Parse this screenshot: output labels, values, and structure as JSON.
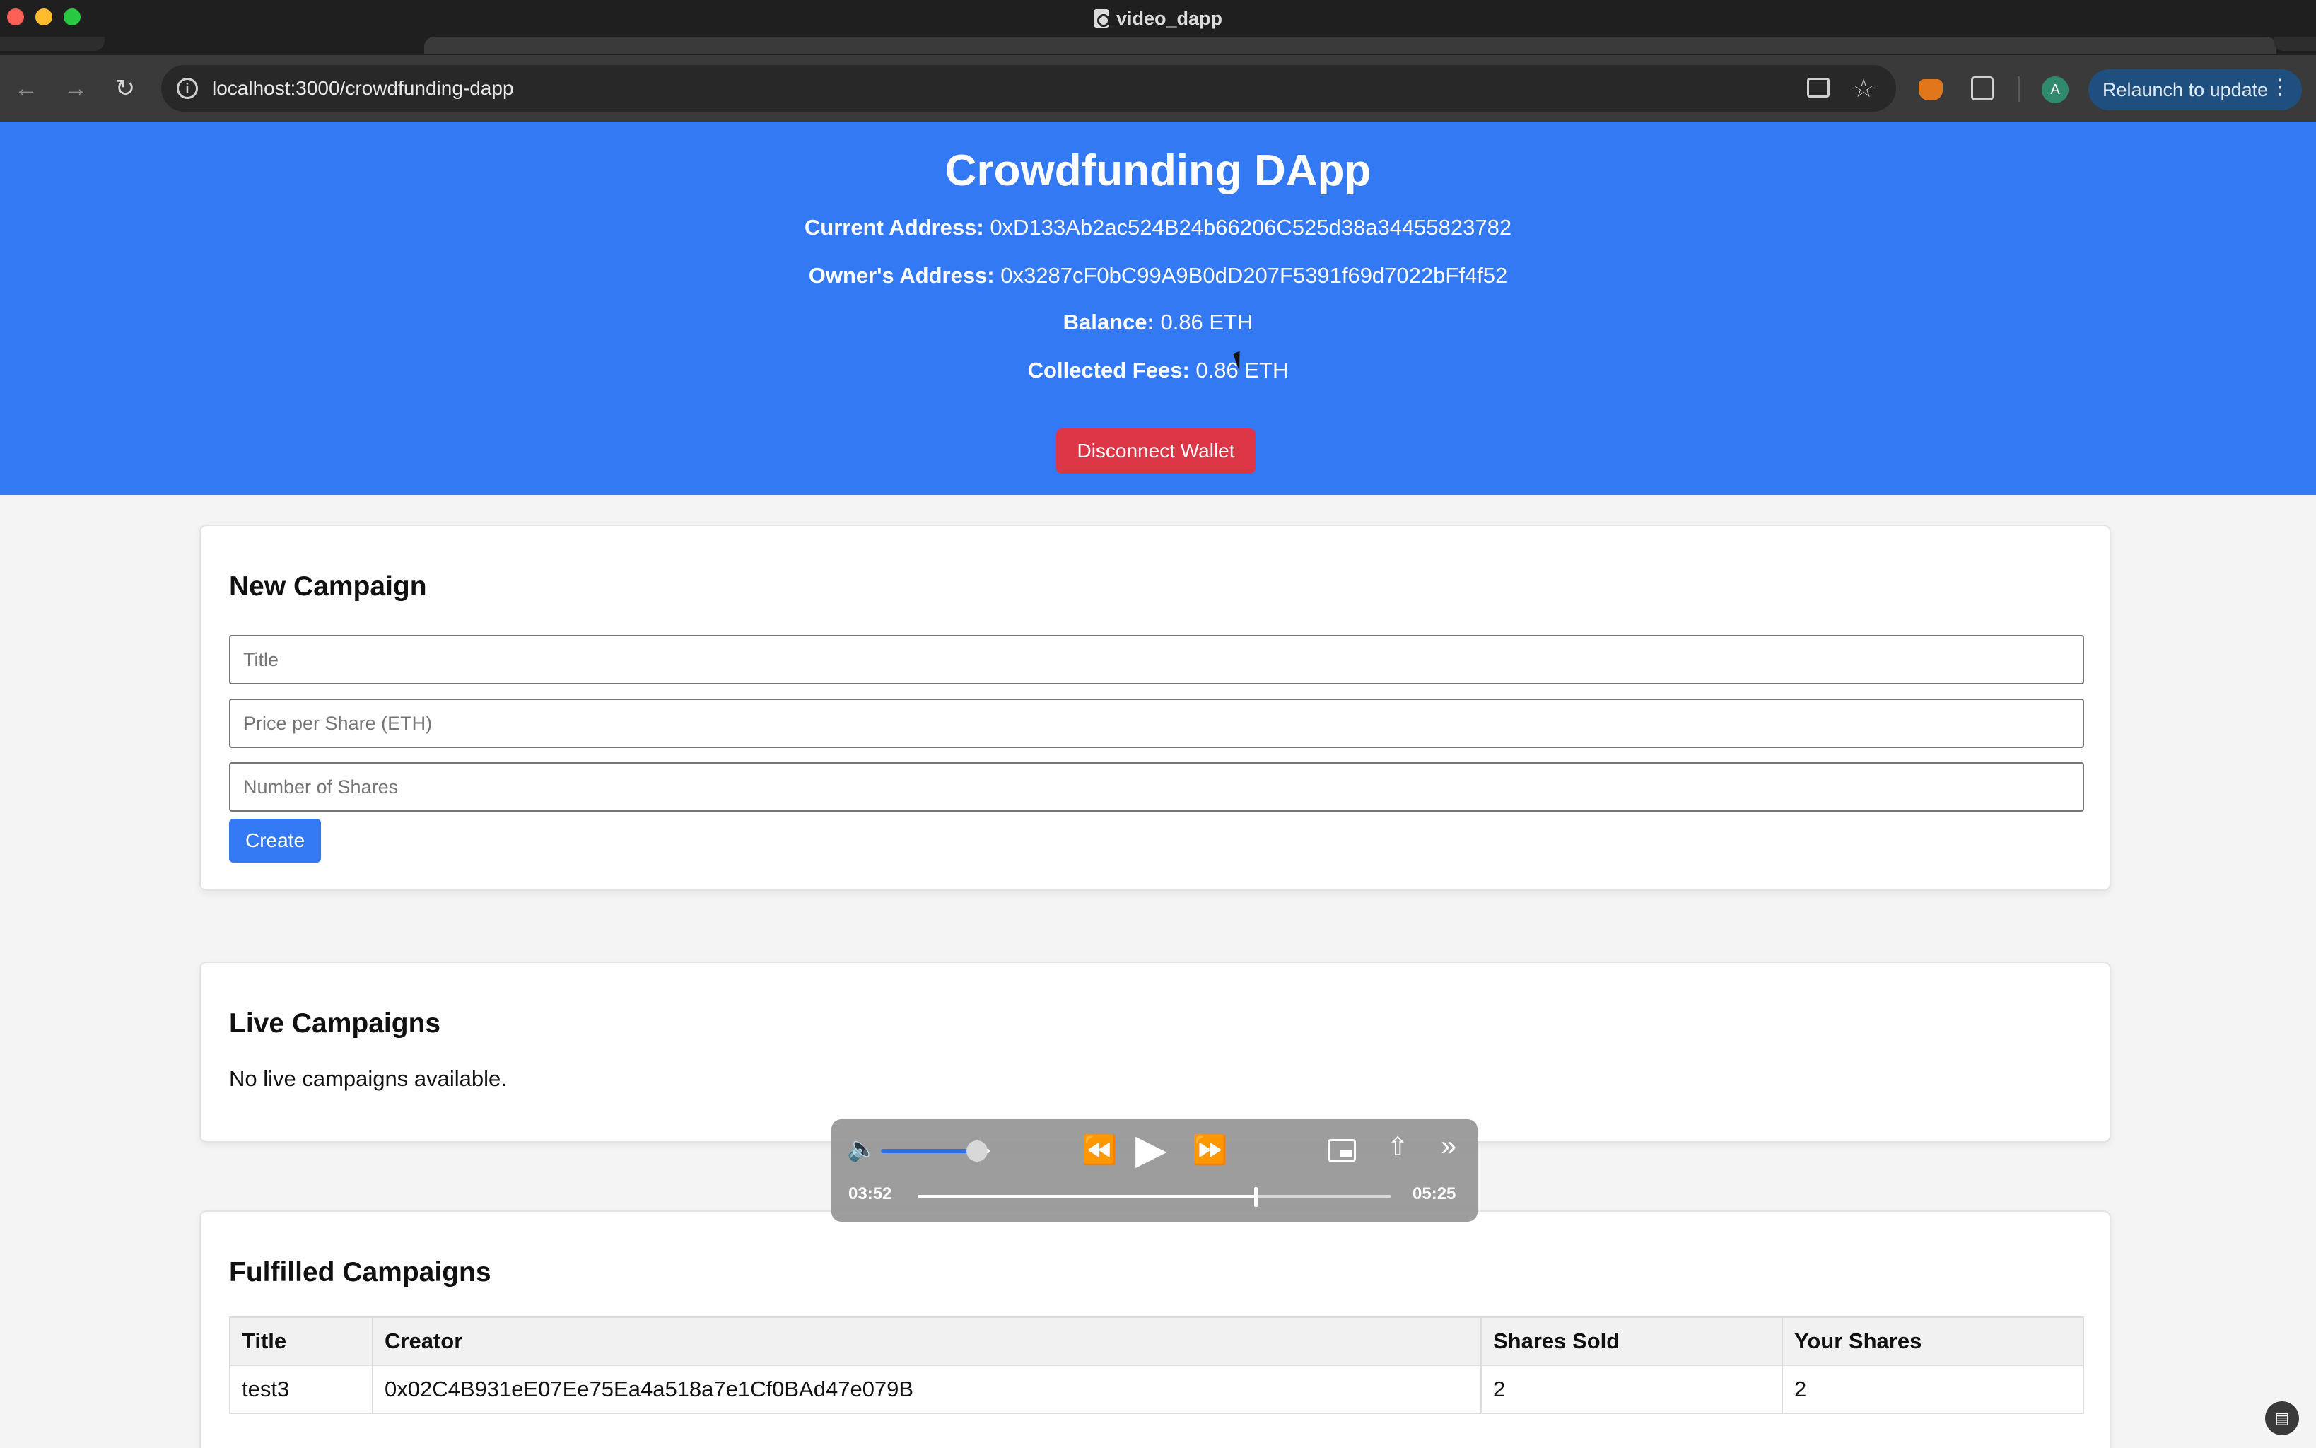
{
  "window": {
    "title": "video_dapp"
  },
  "browser": {
    "url": "localhost:3000/crowdfunding-dapp",
    "relaunch_label": "Relaunch to update",
    "avatar_initial": "A"
  },
  "header": {
    "title": "Crowdfunding DApp",
    "current_address_label": "Current Address:",
    "current_address": "0xD133Ab2ac524B24b66206C525d38a34455823782",
    "owner_address_label": "Owner's Address:",
    "owner_address": "0x3287cF0bC99A9B0dD207F5391f69d7022bFf4f52",
    "balance_label": "Balance:",
    "balance": "0.86 ETH",
    "fees_label": "Collected Fees:",
    "fees": "0.86 ETH",
    "disconnect_label": "Disconnect Wallet",
    "bg_color": "#3479f4",
    "disconnect_color": "#dc3545"
  },
  "new_campaign": {
    "heading": "New Campaign",
    "title_placeholder": "Title",
    "price_placeholder": "Price per Share (ETH)",
    "shares_placeholder": "Number of Shares",
    "create_label": "Create"
  },
  "live_campaigns": {
    "heading": "Live Campaigns",
    "empty_message": "No live campaigns available."
  },
  "fulfilled_campaigns": {
    "heading": "Fulfilled Campaigns",
    "columns": [
      "Title",
      "Creator",
      "Shares Sold",
      "Your Shares"
    ],
    "rows": [
      [
        "test3",
        "0x02C4B931eE07Ee75Ea4a518a7e1Cf0BAd47e079B",
        "2",
        "2"
      ]
    ]
  },
  "player": {
    "elapsed": "03:52",
    "total": "05:25",
    "progress": 0.714,
    "volume": 0.88,
    "icons": [
      "volume-icon",
      "rewind-icon",
      "play-icon",
      "fast-forward-icon",
      "picture-in-picture-icon",
      "share-icon",
      "more-icon"
    ]
  }
}
